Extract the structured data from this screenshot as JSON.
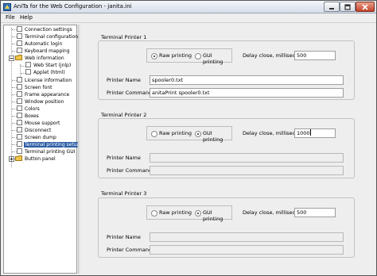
{
  "window": {
    "title": "AniTa for the Web Configuration - janita.ini"
  },
  "menu": {
    "items": [
      "File",
      "Help"
    ]
  },
  "tree": {
    "items": [
      {
        "label": "Connection settings"
      },
      {
        "label": "Terminal configuration"
      },
      {
        "label": "Automatic login"
      },
      {
        "label": "Keyboard mapping"
      },
      {
        "label": "Web information",
        "folder": true,
        "expanded": true
      },
      {
        "label": "Web Start (jnlp)"
      },
      {
        "label": "Applet (html)"
      },
      {
        "label": "License information"
      },
      {
        "label": "Screen font"
      },
      {
        "label": "Frame appearance"
      },
      {
        "label": "Window position"
      },
      {
        "label": "Colors"
      },
      {
        "label": "Boxes"
      },
      {
        "label": "Mouse support"
      },
      {
        "label": "Disconnect"
      },
      {
        "label": "Screen dump"
      },
      {
        "label": "Terminal printing setup",
        "selected": true
      },
      {
        "label": "Terminal printing GUI"
      },
      {
        "label": "Button panel",
        "folder": true,
        "expanded": false
      }
    ]
  },
  "printers": [
    {
      "title": "Terminal Printer 1",
      "raw_label": "Raw printing",
      "gui_label": "GUI printing",
      "selected": "raw",
      "delay_label": "Delay close, milliseconds",
      "delay_value": "500",
      "name_label": "Printer Name",
      "name_value": "spooler0.txt",
      "command_label": "Printer Command",
      "command_value": "anitaPrint spooler0.txt",
      "enabled": true
    },
    {
      "title": "Terminal Printer 2",
      "raw_label": "Raw printing",
      "gui_label": "GUI printing",
      "selected": "gui",
      "delay_label": "Delay close, milliseconds",
      "delay_value": "1000",
      "name_label": "Printer Name",
      "name_value": "",
      "command_label": "Printer Command",
      "command_value": "",
      "enabled": false
    },
    {
      "title": "Terminal Printer 3",
      "raw_label": "Raw printing",
      "gui_label": "GUI printing",
      "selected": "gui",
      "delay_label": "Delay close, milliseconds",
      "delay_value": "500",
      "name_label": "Printer Name",
      "name_value": "",
      "command_label": "Printer Command",
      "command_value": "",
      "enabled": false
    }
  ],
  "icons": {
    "app": "anita-app-icon",
    "minimize": "minimize-icon",
    "maximize": "maximize-icon",
    "close": "close-icon",
    "leaf": "document-leaf-icon",
    "folder": "folder-icon"
  },
  "colors": {
    "selection": "#2f5fa6",
    "close_button": "#c4432a"
  }
}
